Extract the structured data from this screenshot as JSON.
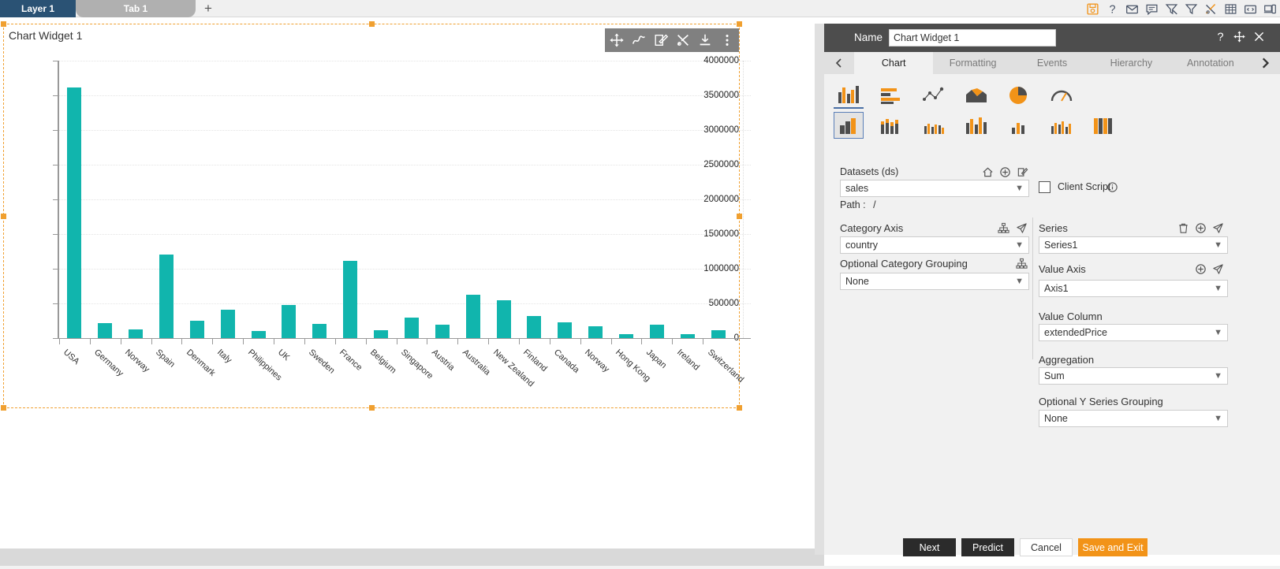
{
  "top_bar": {
    "tabs": [
      {
        "label": "Layer 1",
        "active": true
      },
      {
        "label": "Tab 1",
        "active": false
      }
    ],
    "add_label": "+",
    "icons": [
      "save-icon",
      "help-icon",
      "mail-icon",
      "comment-icon",
      "clear-filter-icon",
      "filter-icon",
      "tools-icon",
      "table-icon",
      "code-icon",
      "device-icon"
    ]
  },
  "widget": {
    "title": "Chart Widget 1",
    "toolbar_icons": [
      "move-icon",
      "pen-icon",
      "edit-icon",
      "tools-icon",
      "download-icon",
      "more-icon"
    ]
  },
  "chart_data": {
    "type": "bar",
    "title": "",
    "xlabel": "",
    "ylabel": "",
    "ylim": [
      0,
      4000000
    ],
    "ytick_labels": [
      "0",
      "500000",
      "1000000",
      "1500000",
      "2000000",
      "2500000",
      "3000000",
      "3500000",
      "4000000"
    ],
    "yticks": [
      0,
      500000,
      1000000,
      1500000,
      2000000,
      2500000,
      3000000,
      3500000,
      4000000
    ],
    "grid": true,
    "legend": false,
    "series_name": "Series1",
    "bar_color": "#11b5ad",
    "categories": [
      "USA",
      "Germany",
      "Norway",
      "Spain",
      "Denmark",
      "Italy",
      "Philippines",
      "UK",
      "Sweden",
      "France",
      "Belgium",
      "Singapore",
      "Austria",
      "Australia",
      "New Zealand",
      "Finland",
      "Canada",
      "Norway",
      "Hong Kong",
      "Japan",
      "Ireland",
      "Switzerland"
    ],
    "values": [
      3610000,
      220000,
      120000,
      1210000,
      250000,
      410000,
      100000,
      480000,
      200000,
      1115000,
      110000,
      300000,
      195000,
      620000,
      540000,
      320000,
      225000,
      175000,
      55000,
      195000,
      60000,
      110000
    ]
  },
  "panel": {
    "header": {
      "name_label": "Name",
      "name_value": "Chart Widget 1",
      "icons": [
        "help-icon",
        "move-icon",
        "close-icon"
      ]
    },
    "tabs": [
      {
        "label": "Chart",
        "active": true
      },
      {
        "label": "Formatting",
        "active": false
      },
      {
        "label": "Events",
        "active": false
      },
      {
        "label": "Hierarchy",
        "active": false
      },
      {
        "label": "Annotation",
        "active": false
      }
    ],
    "nav_prev": "chevron-left-icon",
    "nav_next": "chevron-right-icon",
    "chart_type_row1": [
      "column-chart-icon",
      "bar-chart-icon",
      "scatter-chart-icon",
      "area-chart-icon",
      "pie-chart-icon",
      "gauge-chart-icon"
    ],
    "chart_type_row2": [
      "clustered-column-icon",
      "stacked-column-icon",
      "grouped-column-icon",
      "multi-column-icon",
      "small-column-icon",
      "mixed-column-icon",
      "wide-column-icon"
    ],
    "datasets": {
      "label": "Datasets (ds)",
      "value": "sales",
      "path_label": "Path :",
      "path_value": "/",
      "icons": [
        "home-icon",
        "add-icon",
        "edit-icon"
      ]
    },
    "client_script": {
      "label": "Client Script",
      "checked": false,
      "info_icon": "info-icon"
    },
    "left_column": {
      "category_axis_label": "Category Axis",
      "category_axis_value": "country",
      "category_axis_icons": [
        "hierarchy-icon",
        "send-icon"
      ],
      "optional_grouping_label": "Optional Category Grouping",
      "optional_grouping_value": "None",
      "optional_grouping_icon": "hierarchy-icon"
    },
    "right_column": {
      "series_label": "Series",
      "series_icons": [
        "delete-icon",
        "add-icon",
        "send-icon"
      ],
      "series_value": "Series1",
      "value_axis_label": "Value Axis",
      "value_axis_icons": [
        "add-icon",
        "send-icon"
      ],
      "value_axis_value": "Axis1",
      "value_column_label": "Value Column",
      "value_column_value": "extendedPrice",
      "aggregation_label": "Aggregation",
      "aggregation_value": "Sum",
      "y_grouping_label": "Optional Y Series Grouping",
      "y_grouping_value": "None"
    },
    "buttons": {
      "next": "Next",
      "predict": "Predict",
      "cancel": "Cancel",
      "save_exit": "Save and Exit"
    }
  },
  "colors": {
    "accent_orange": "#f29318",
    "teal": "#11b5ad",
    "layer_tab_blue": "#2a5274",
    "panel_dark": "#4d4d4d"
  }
}
